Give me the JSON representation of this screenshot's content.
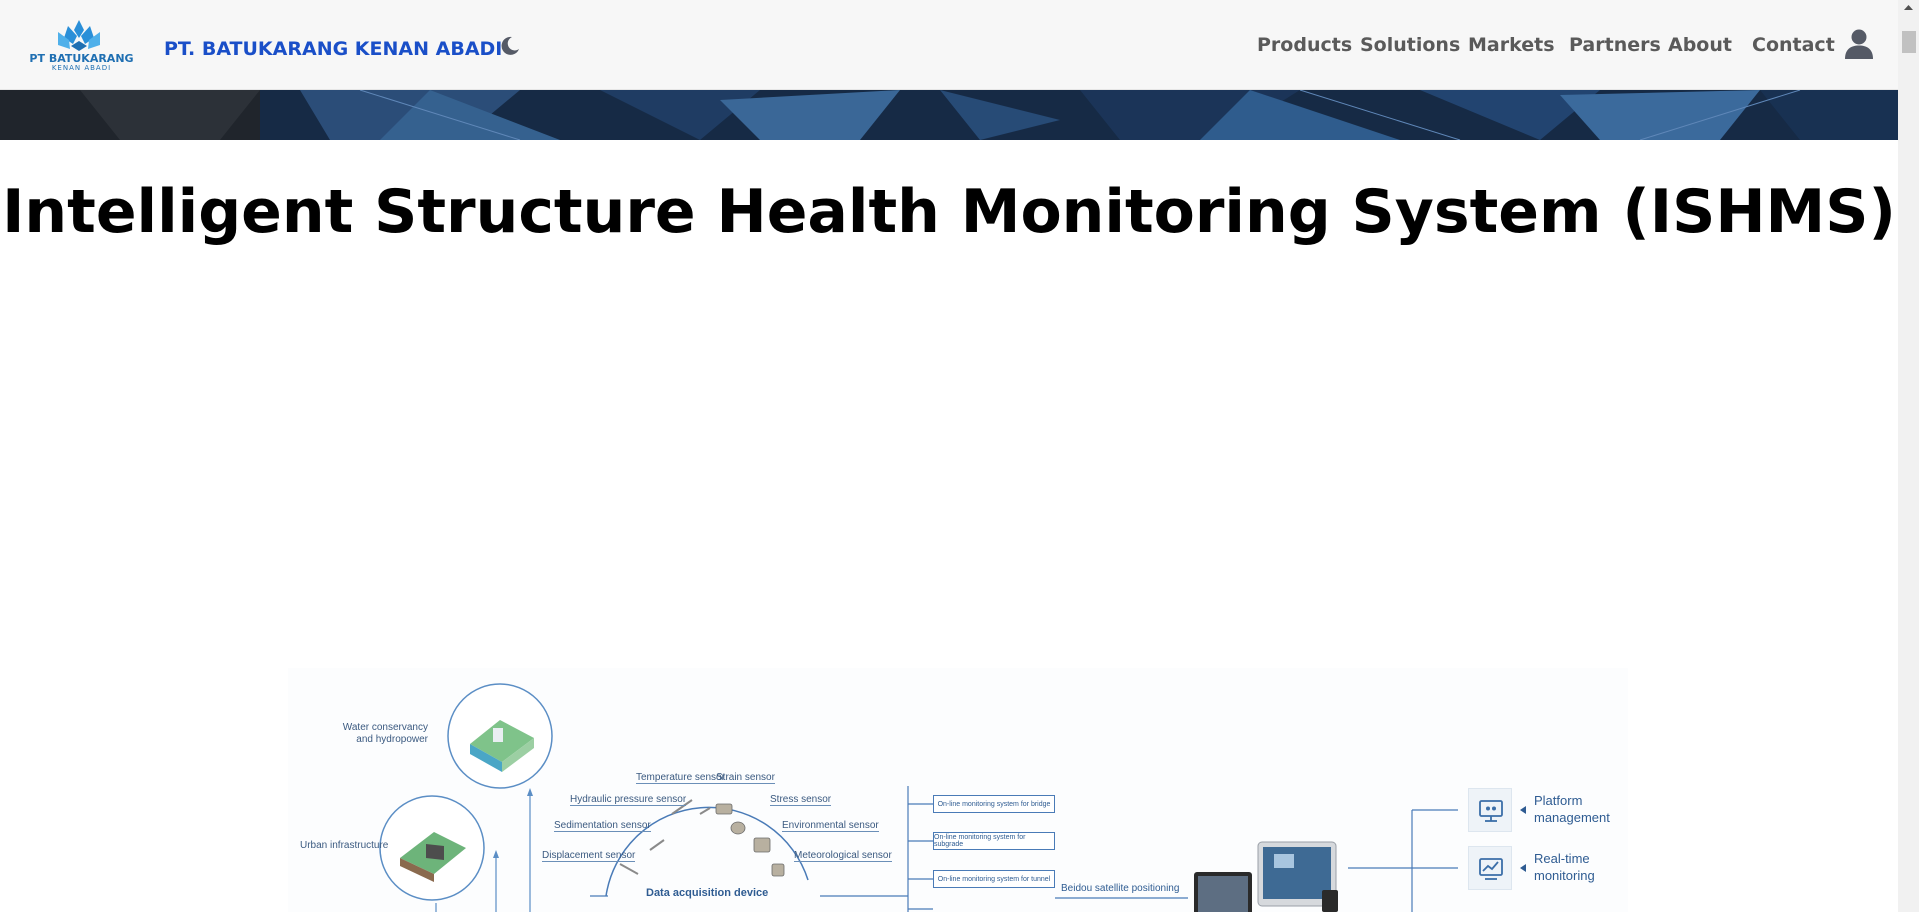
{
  "header": {
    "logo": {
      "name": "PT BATUKARANG",
      "sub": "KENAN ABADI"
    },
    "brand": "PT. BATUKARANG KENAN ABADI",
    "nav": [
      {
        "id": "products",
        "label": "Products"
      },
      {
        "id": "solutions",
        "label": "Solutions"
      },
      {
        "id": "markets",
        "label": "Markets"
      },
      {
        "id": "partners",
        "label": "Partners"
      },
      {
        "id": "about",
        "label": "About"
      },
      {
        "id": "contact",
        "label": "Contact"
      }
    ],
    "icons": {
      "theme": "moon-icon",
      "user": "user-icon"
    }
  },
  "main": {
    "title": "Intelligent Structure Health Monitoring System (ISHMS)"
  },
  "diagram": {
    "applications": {
      "water": "Water conservancy\nand hydropower",
      "urban": "Urban infrastructure"
    },
    "sensors": {
      "temperature": "Temperature sensor",
      "strain": "Strain sensor",
      "hydraulic": "Hydraulic pressure sensor",
      "stress": "Stress sensor",
      "sedimentation": "Sedimentation sensor",
      "environmental": "Environmental sensor",
      "displacement": "Displacement sensor",
      "meteorological": "Meteorological sensor"
    },
    "acquisition": "Data acquisition device",
    "systems": {
      "bridge": "On-line monitoring system for bridge",
      "subgrade": "On-line monitoring system for subgrade",
      "tunnel": "On-line monitoring system for tunnel"
    },
    "beidou": "Beidou satellite positioning",
    "features": {
      "platform": "Platform\nmanagement",
      "realtime": "Real-time\nmonitoring"
    }
  },
  "colors": {
    "brand": "#1a4fc8",
    "nav_text": "#5a5a5a",
    "diagram_accent": "#4a7bb7"
  }
}
